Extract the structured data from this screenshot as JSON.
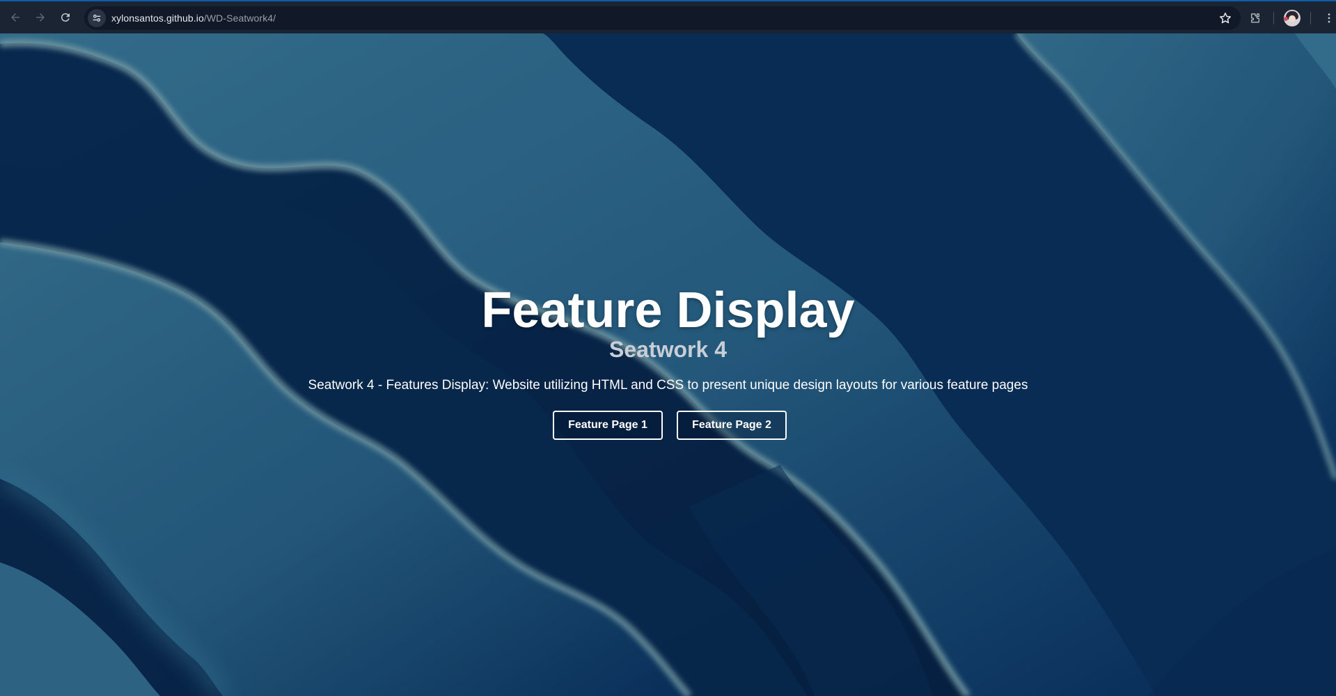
{
  "browser": {
    "url_domain": "xylonsantos.github.io",
    "url_path": "/WD-Seatwork4/",
    "icons": {
      "back": "arrow-left-icon",
      "forward": "arrow-right-icon",
      "reload": "reload-icon",
      "site_info": "tune-icon",
      "bookmark": "star-icon",
      "extensions": "puzzle-icon",
      "profile": "avatar"
    }
  },
  "hero": {
    "title": "Feature Display",
    "subtitle": "Seatwork 4",
    "description": "Seatwork 4 - Features Display: Website utilizing HTML and CSS to present unique design layouts for various feature pages",
    "buttons": [
      {
        "label": "Feature Page 1"
      },
      {
        "label": "Feature Page 2"
      }
    ]
  },
  "colors": {
    "chrome_bg": "#1b2433",
    "omnibox_bg": "#111928",
    "wave_dark": "#062446",
    "wave_light": "#3f7b97",
    "wave_crest": "#7aa8b0",
    "text_primary": "#ffffff",
    "text_subtitle": "#c9ced6"
  }
}
